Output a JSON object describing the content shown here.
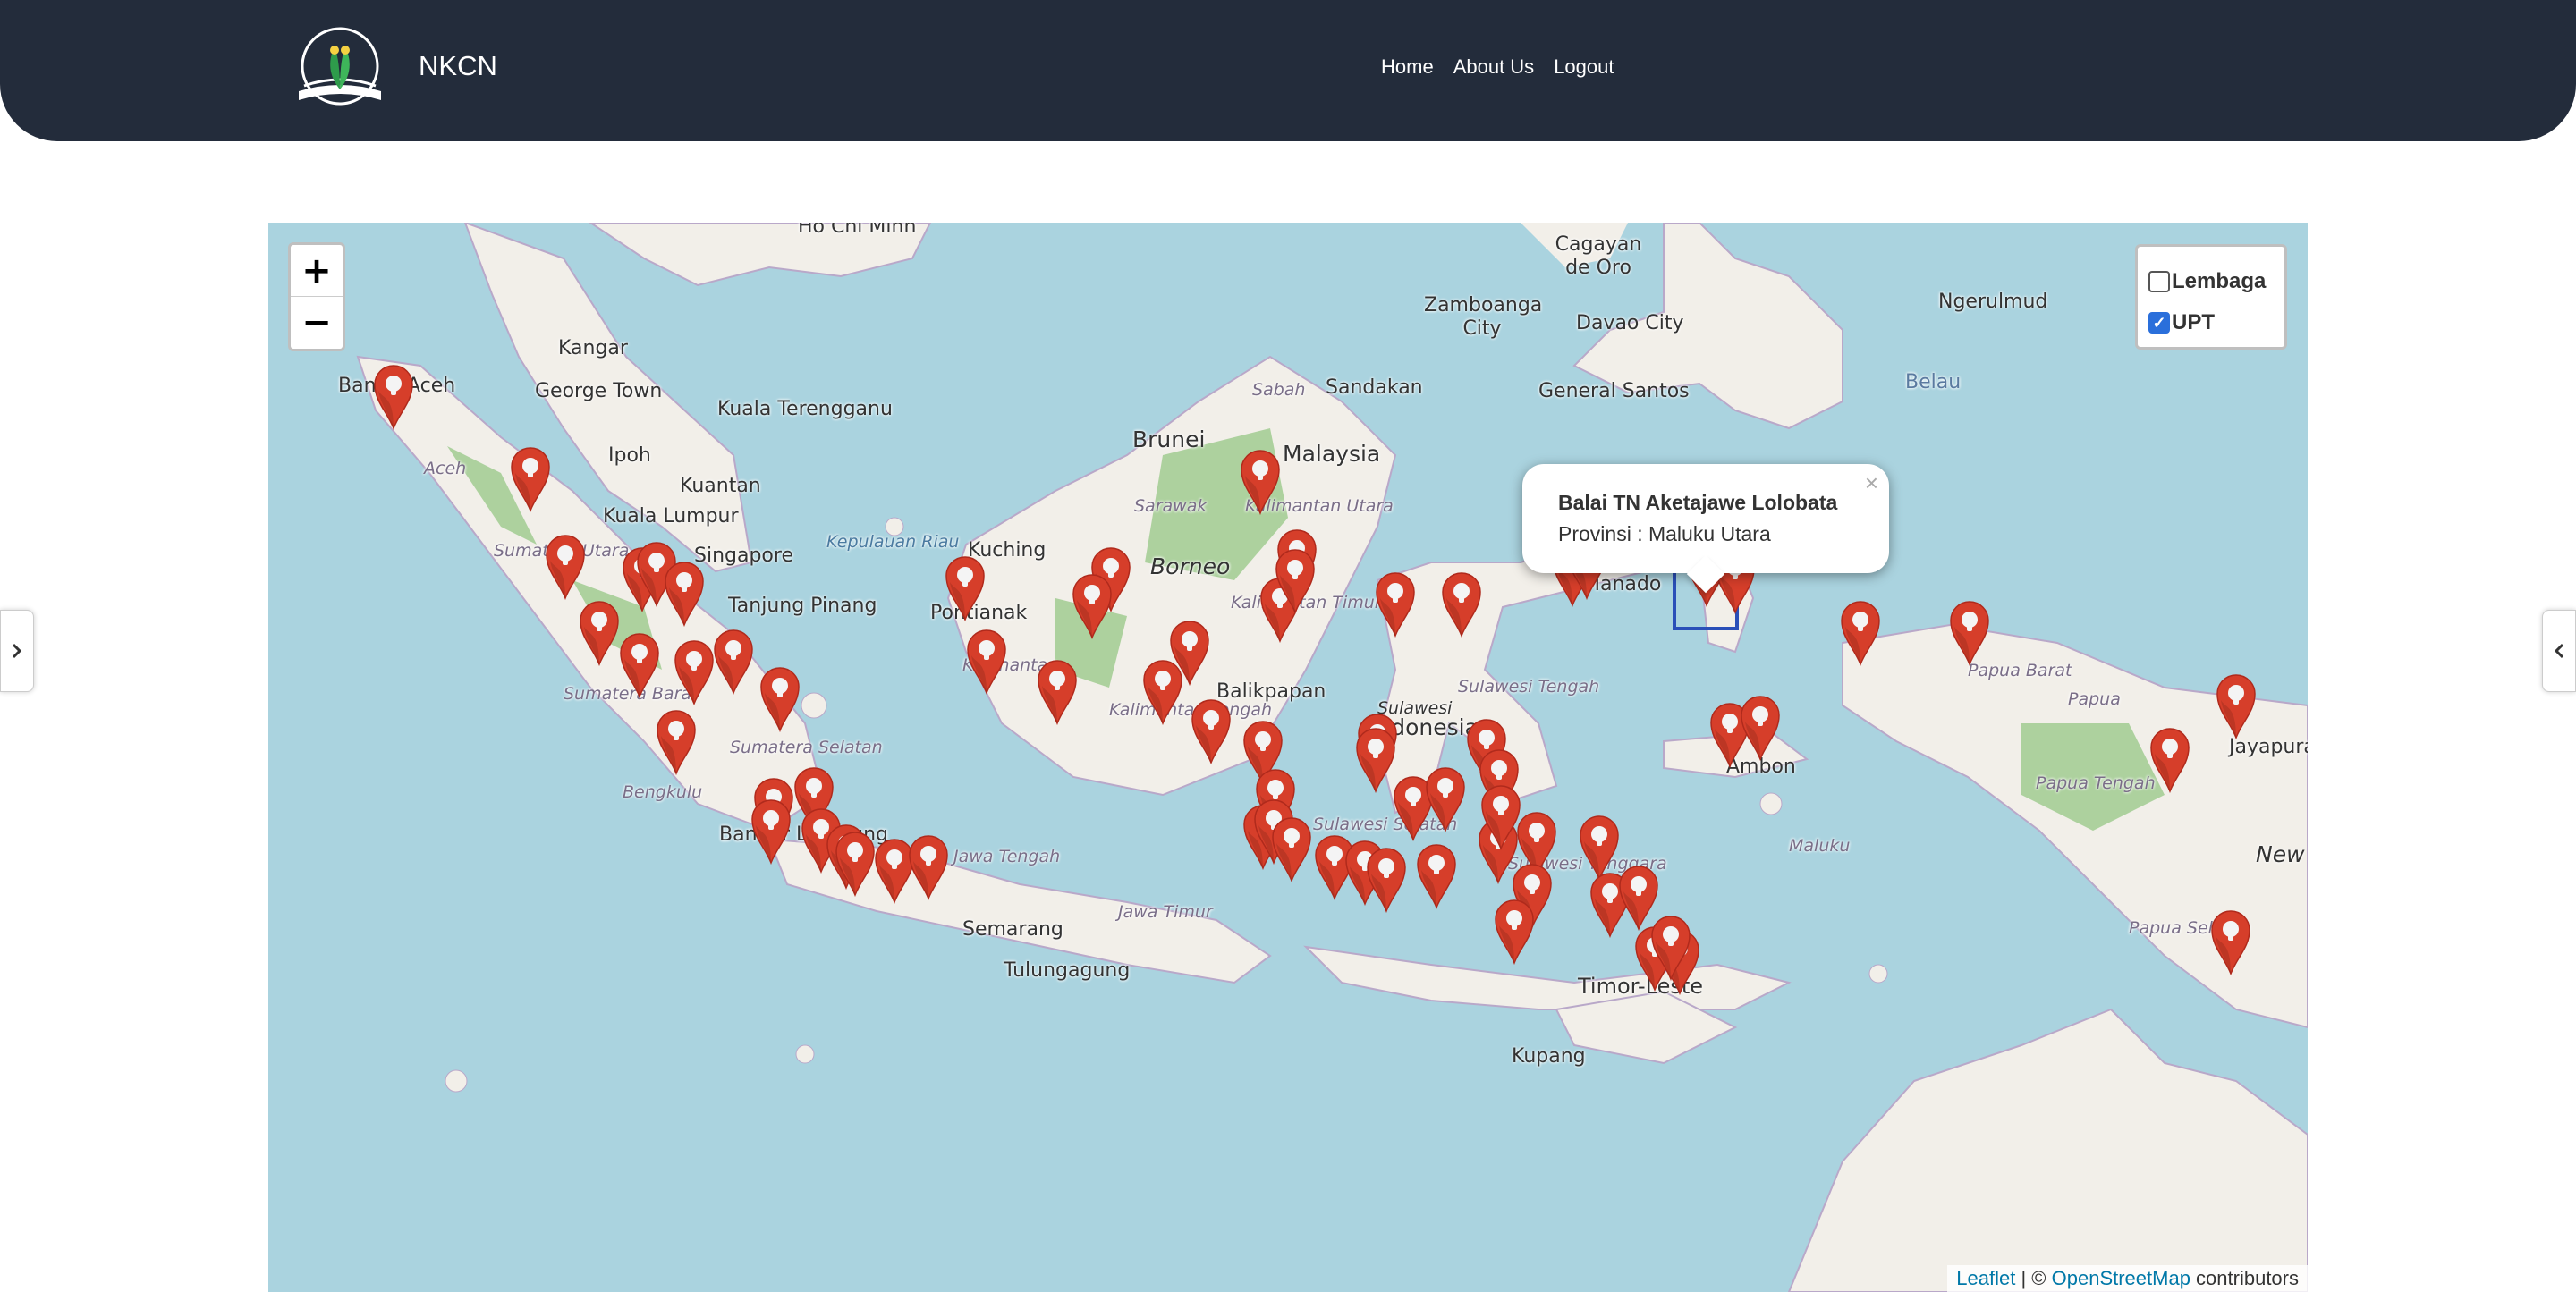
{
  "header": {
    "brand": "NKCN",
    "nav": [
      "Home",
      "About Us",
      "Logout"
    ]
  },
  "map": {
    "zoom_in": "+",
    "zoom_out": "−",
    "layers": [
      {
        "label": "Lembaga",
        "checked": false
      },
      {
        "label": "UPT",
        "checked": true
      }
    ],
    "popup": {
      "title": "Balai TN Aketajawe Lolobata",
      "subtitle": "Provinsi : Maluku Utara",
      "close": "×"
    },
    "attribution": {
      "leaflet": "Leaflet",
      "sep": " | © ",
      "osm": "OpenStreetMap",
      "suffix": " contributors"
    },
    "places": [
      "Ho Chi Minh",
      "Cagayan de Oro",
      "Zamboanga City",
      "Davao City",
      "Ngerulmud",
      "Banda Aceh",
      "Kangar",
      "George Town",
      "Kuala Terengganu",
      "Ipoh",
      "Kuantan",
      "Kuala Lumpur",
      "Singapore",
      "Tanjung Pinang",
      "Kuching",
      "Brunei",
      "Malaysia",
      "Sabah",
      "Sandakan",
      "General Santos",
      "Belau",
      "Borneo",
      "Sarawak",
      "Balikpapan",
      "Sulawesi",
      "Indonesia",
      "Pontianak",
      "Papua Barat",
      "Papua",
      "Papua Tengah",
      "Jayapura",
      "New Guinea",
      "Papua Selatan",
      "Timor-Leste",
      "Kupang",
      "Maluku",
      "Jawa Tengah",
      "Jawa Timur",
      "Semarang",
      "Tulungagung",
      "Bandar Lampung",
      "Aceh",
      "Sumatera Utara",
      "Sumatera Barat",
      "Sumatera Selatan",
      "Bengkulu",
      "Kepulauan Riau",
      "Kalimantan",
      "Kalimantan Tengah",
      "Kalimantan Timur",
      "Kalimantan Utara",
      "Sulawesi Tengah",
      "Sulawesi Selatan",
      "Sulawesi Tenggara",
      "Manado",
      "Ambon"
    ],
    "marker_count": 71
  },
  "colors": {
    "header_bg": "#232c3b",
    "marker": "#d63e2a",
    "sea": "#aad3df",
    "land": "#f2efe9",
    "forest": "#add19e"
  }
}
